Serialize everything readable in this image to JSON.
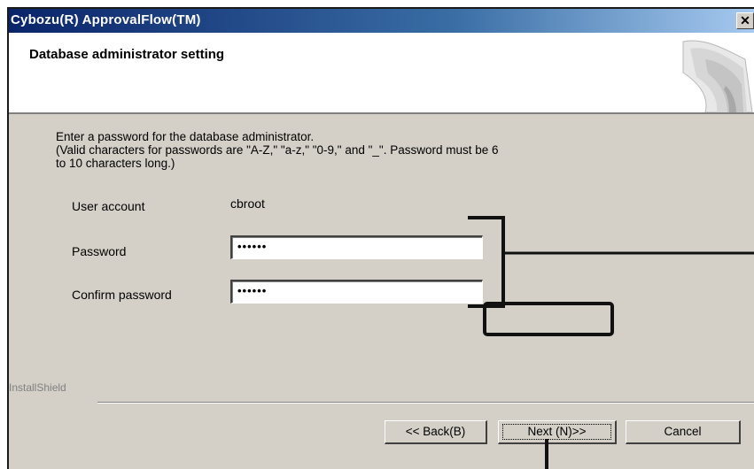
{
  "window": {
    "title": "Cybozu(R) ApprovalFlow(TM)",
    "close_glyph": "✕"
  },
  "header": {
    "title": "Database administrator setting"
  },
  "content": {
    "instruction": "Enter a password for the database administrator.",
    "note_line1": "(Valid characters for passwords are \"A-Z,\" \"a-z,\" \"0-9,\" and \"_\". Password must be 6",
    "note_line2": "to 10 characters long.)",
    "user_account_label": "User account",
    "user_account_value": "cbroot",
    "password_label": "Password",
    "password_value": "••••••",
    "confirm_label": "Confirm password",
    "confirm_value": "••••••"
  },
  "footer": {
    "brand": "InstallShield",
    "back_label": "<< Back(B)",
    "next_label": "Next (N)>>",
    "cancel_label": "Cancel"
  }
}
